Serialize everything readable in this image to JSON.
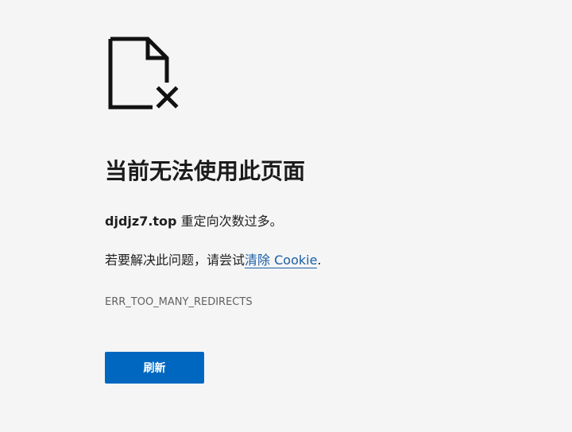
{
  "error_icon": "document-error-icon",
  "title": "当前无法使用此页面",
  "host": {
    "name": "djdjz7.top",
    "message": " 重定向次数过多。"
  },
  "suggestion": {
    "prefix": "若要解决此问题，请尝试",
    "link_label": "清除 Cookie",
    "suffix": "."
  },
  "error_code": "ERR_TOO_MANY_REDIRECTS",
  "refresh_label": "刷新",
  "colors": {
    "background": "#f5f5f5",
    "accent": "#0067c0",
    "link": "#1a5fa8",
    "secondary_text": "#616161"
  }
}
